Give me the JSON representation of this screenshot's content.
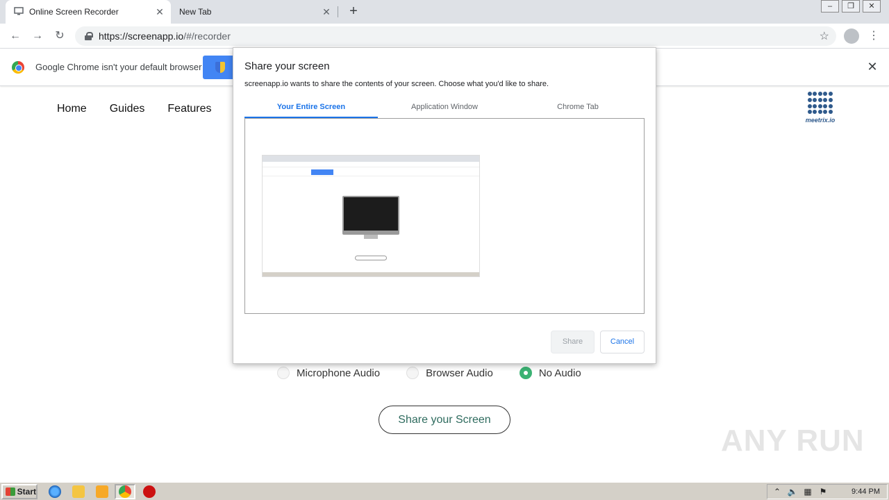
{
  "browser": {
    "tabs": [
      {
        "title": "Online Screen Recorder",
        "icon": "monitor-icon"
      },
      {
        "title": "New Tab"
      }
    ],
    "url_host": "https://screenapp.io",
    "url_path": "/#/recorder"
  },
  "infobar": {
    "message": "Google Chrome isn't your default browser"
  },
  "site": {
    "nav": [
      "Home",
      "Guides",
      "Features"
    ],
    "brand": "meetrix.io",
    "audio_options": [
      {
        "label": "Microphone Audio",
        "checked": false
      },
      {
        "label": "Browser Audio",
        "checked": false
      },
      {
        "label": "No Audio",
        "checked": true
      }
    ],
    "share_button": "Share your Screen",
    "watermark": "ANY RUN"
  },
  "dialog": {
    "title": "Share your screen",
    "description": "screenapp.io wants to share the contents of your screen. Choose what you'd like to share.",
    "tabs": [
      "Your Entire Screen",
      "Application Window",
      "Chrome Tab"
    ],
    "active_tab": "Your Entire Screen",
    "share_label": "Share",
    "cancel_label": "Cancel"
  },
  "taskbar": {
    "start_label": "Start",
    "clock": "9:44 PM"
  },
  "colors": {
    "accent": "#1a73e8",
    "radio_checked": "#3bb273",
    "infobar_button": "#4285f4"
  }
}
